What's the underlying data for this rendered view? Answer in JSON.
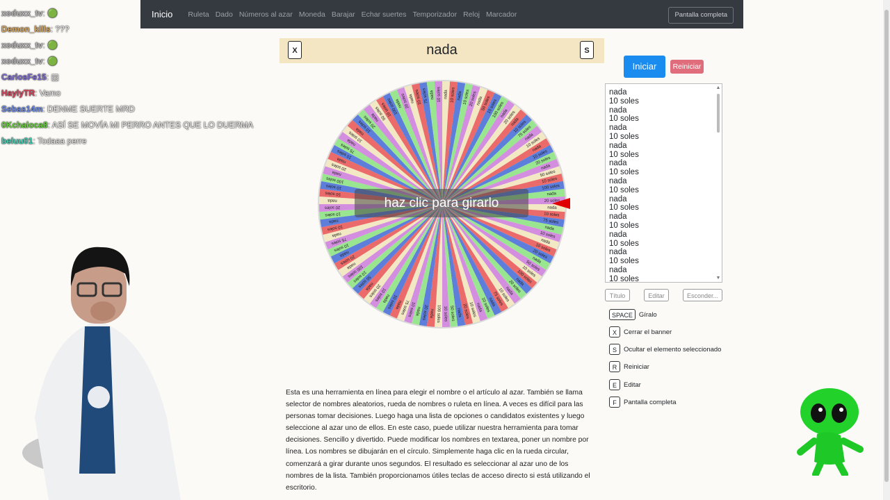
{
  "navbar": {
    "brand": "Inicio",
    "links": [
      "Ruleta",
      "Dado",
      "Números al azar",
      "Moneda",
      "Barajar",
      "Echar suertes",
      "Temporizador",
      "Reloj",
      "Marcador"
    ],
    "fullscreen": "Pantalla completa"
  },
  "banner": {
    "title": "nada",
    "close_key": "X",
    "hide_key": "S"
  },
  "wheel": {
    "center_label": "haz clic para girarlo",
    "slice_colors": [
      "#f2e8c4",
      "#eb6a6a",
      "#5d7fdb",
      "#9ae58f",
      "#d48ee0"
    ],
    "options": [
      "nada",
      "10 soles",
      "nada",
      "10 soles",
      "20 soles",
      "nada",
      "50 soles",
      "10 soles",
      "100 soles",
      "nada",
      "20 soles",
      "nada",
      "10 soles",
      "75 soles"
    ]
  },
  "controls": {
    "start": "Iniciar",
    "reset": "Reiniciar"
  },
  "options_list": [
    "nada",
    "10 soles",
    "nada",
    "10 soles",
    "nada",
    "10 soles",
    "nada",
    "10 soles",
    "nada",
    "10 soles",
    "nada",
    "10 soles",
    "nada",
    "10 soles",
    "nada",
    "10 soles",
    "nada",
    "10 soles",
    "nada",
    "10 soles",
    "nada",
    "10 soles"
  ],
  "list_buttons": {
    "title": "Título",
    "edit": "Editar",
    "hide": "Esconder..."
  },
  "shortcuts": [
    {
      "key": "SPACE",
      "label": "Gíralo"
    },
    {
      "key": "X",
      "label": "Cerrar el banner"
    },
    {
      "key": "S",
      "label": "Ocultar el elemento seleccionado"
    },
    {
      "key": "R",
      "label": "Reiniciar"
    },
    {
      "key": "E",
      "label": "Editar"
    },
    {
      "key": "F",
      "label": "Pantalla completa"
    }
  ],
  "description": "Esta es una herramienta en línea para elegir el nombre o el artículo al azar. También se llama selector de nombres aleatorios, rueda de nombres o ruleta en línea. A veces es difícil para las personas tomar decisiones. Luego haga una lista de opciones o candidatos existentes y luego seleccione al azar uno de ellos. En este caso, puede utilizar nuestra herramienta para tomar decisiones. Sencillo y divertido. Puede modificar los nombres en textarea, poner un nombre por línea. Los nombres se dibujarán en el círculo. Simplemente haga clic en la rueda circular, comenzará a girar durante unos segundos. El resultado es seleccionar al azar uno de los nombres de la lista. También proporcionamos útiles teclas de acceso directo si está utilizando el escritorio.",
  "chat": [
    {
      "user": "xoduxx_tv",
      "sep": ":",
      "msg": "🟢",
      "color": "#b9b9b9"
    },
    {
      "user": "Demon_kills",
      "sep": ":",
      "msg": "???",
      "color": "#d8a45a"
    },
    {
      "user": "xoduxx_tv",
      "sep": ":",
      "msg": "🟢",
      "color": "#b9b9b9"
    },
    {
      "user": "xoduxx_tv",
      "sep": ":",
      "msg": "🟢",
      "color": "#b9b9b9"
    },
    {
      "user": "CarlosFe15",
      "sep": ":",
      "msg": "▩",
      "color": "#7e6bd8"
    },
    {
      "user": "HaylyTR",
      "sep": ":",
      "msg": "Vamo",
      "color": "#e0405a"
    },
    {
      "user": "Sebas14m",
      "sep": ":",
      "msg": "DENME SUERTE MRD",
      "color": "#6b8ae8"
    },
    {
      "user": "0Kchaloca8",
      "sep": ":",
      "msg": "ASÍ SE MOVÍA MI PERRO ANTES QUE LO DUERMA",
      "color": "#66d63a"
    },
    {
      "user": "beluu01",
      "sep": ":",
      "msg": "Todaaa perre",
      "color": "#3fd0b4"
    }
  ],
  "colors": {
    "navbar": "#343a40",
    "accent": "#1a8cf0",
    "reset": "#e06d7c",
    "banner": "#f4e5c3",
    "pointer": "#e00000"
  }
}
